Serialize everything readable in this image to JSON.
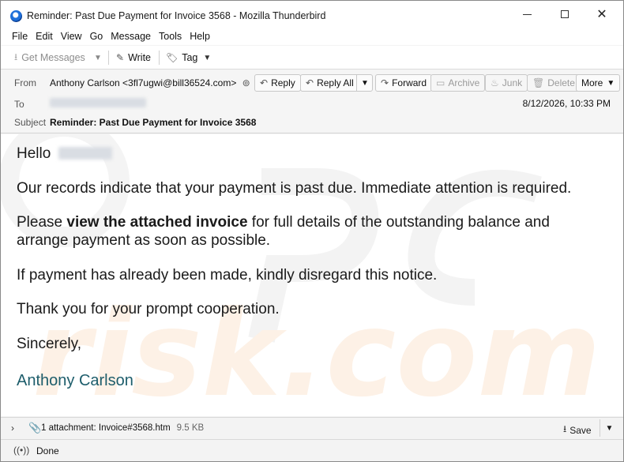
{
  "window": {
    "title": "Reminder: Past Due Payment for Invoice 3568 - Mozilla Thunderbird",
    "app_icon": "thunderbird-icon"
  },
  "menu": [
    "File",
    "Edit",
    "View",
    "Go",
    "Message",
    "Tools",
    "Help"
  ],
  "toolbar": {
    "get_messages": "Get Messages",
    "write": "Write",
    "tag": "Tag"
  },
  "header": {
    "from_label": "From",
    "from_value": "Anthony Carlson <3fl7ugwi@bill36524.com>",
    "to_label": "To",
    "subject_label": "Subject",
    "subject_value": "Reminder: Past Due Payment for Invoice 3568",
    "date": "8/12/2026, 10:33 PM",
    "buttons": {
      "reply": "Reply",
      "reply_all": "Reply All",
      "forward": "Forward",
      "archive": "Archive",
      "junk": "Junk",
      "delete": "Delete",
      "more": "More"
    }
  },
  "body": {
    "greeting": "Hello",
    "p1": "Our records indicate that your payment is past due. Immediate attention is required.",
    "p2_pre": "Please ",
    "p2_bold": "view the attached invoice",
    "p2_post": " for full details of the outstanding balance and",
    "p2_line2": "arrange payment as soon as possible.",
    "p3": "If payment has already been made, kindly disregard this notice.",
    "p4": "Thank you for your prompt cooperation.",
    "p5": "Sincerely,",
    "signature": "Anthony Carlson",
    "signature_color": "#1d5d6b"
  },
  "attachment": {
    "text": "1 attachment: Invoice#3568.htm",
    "size": "9.5 KB",
    "save": "Save"
  },
  "status": {
    "text": "Done"
  }
}
